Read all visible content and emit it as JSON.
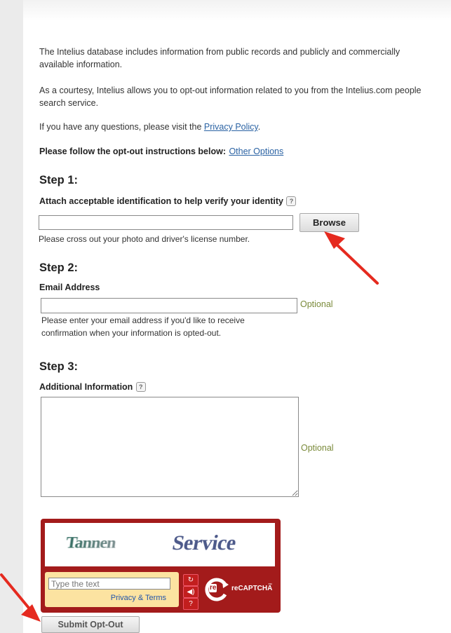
{
  "intro": {
    "p1": "The Intelius database includes information from public records and publicly and commercially available information.",
    "p2": "As a courtesy, Intelius allows you to opt-out information related to you from the Intelius.com people search service.",
    "p3_prefix": "If you have any questions, please visit the ",
    "p3_link": "Privacy Policy",
    "p3_suffix": "."
  },
  "instructions": {
    "label": "Please follow the opt-out instructions below:",
    "link": "Other Options"
  },
  "step1": {
    "title": "Step 1:",
    "label": "Attach acceptable identification to help verify your identity",
    "help_glyph": "?",
    "file_value": "",
    "browse_label": "Browse",
    "note": "Please cross out your photo and driver's license number."
  },
  "step2": {
    "title": "Step 2:",
    "label": "Email Address",
    "email_value": "",
    "optional": "Optional",
    "note_line1": "Please enter your email address if you'd like to receive",
    "note_line2": "confirmation when your information is opted-out."
  },
  "step3": {
    "title": "Step 3:",
    "label": "Additional Information",
    "help_glyph": "?",
    "textarea_value": "",
    "optional": "Optional"
  },
  "captcha": {
    "word1": "Tannen",
    "word2": "Service",
    "input_placeholder": "Type the text",
    "privacy_terms": "Privacy & Terms",
    "logo_text": "reCAPTCHA",
    "logo_re": "re",
    "logo_tm": "™",
    "colors": {
      "frame": "#a31b1b",
      "input_bg": "#fce3a1",
      "link": "#2255aa"
    }
  },
  "submit_label": "Submit Opt-Out",
  "colors": {
    "link": "#2a62a3",
    "optional": "#7a8a3a",
    "arrow": "#e52a1f"
  }
}
